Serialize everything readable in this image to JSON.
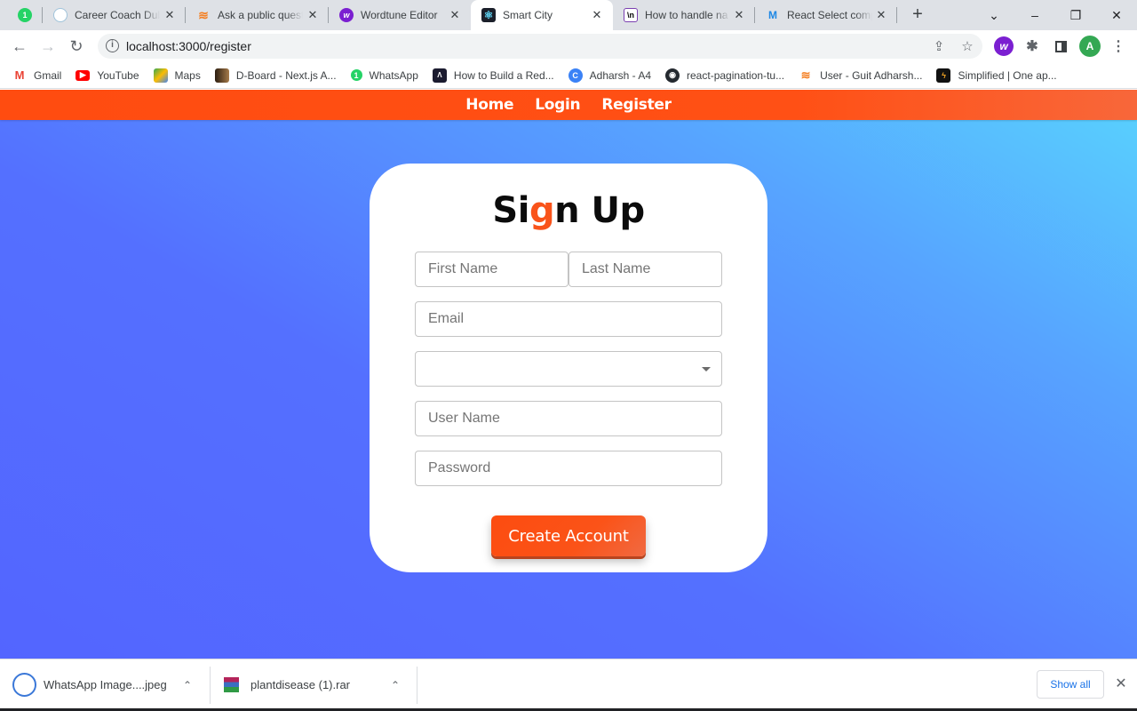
{
  "browser": {
    "tabs": [
      {
        "title": "",
        "icon": "whatsapp-icon",
        "color": "#25d366",
        "badge": "1"
      },
      {
        "title": "Career Coach Dub",
        "icon": "career-coach-icon",
        "color": "#cfe3f0"
      },
      {
        "title": "Ask a public quest",
        "icon": "stackoverflow-icon",
        "color": "#f48024"
      },
      {
        "title": "Wordtune Editor",
        "icon": "wordtune-icon",
        "color": "#7b1fd1"
      },
      {
        "title": "Smart City",
        "icon": "react-icon",
        "color": "#1b1f2a",
        "active": true
      },
      {
        "title": "How to handle na",
        "icon": "dev-icon",
        "color": "#000000"
      },
      {
        "title": "React Select comp",
        "icon": "mui-icon",
        "color": "#1e88e5"
      }
    ],
    "new_tab_label": "+",
    "window_controls": {
      "dropdown": "⌄",
      "minimize": "–",
      "restore": "❐",
      "close": "✕"
    },
    "url": "localhost:3000/register",
    "profile_initial": "A",
    "bookmarks": [
      {
        "label": "Gmail",
        "icon": "gmail-icon",
        "color": "#ea4335"
      },
      {
        "label": "YouTube",
        "icon": "youtube-icon",
        "color": "#ff0000"
      },
      {
        "label": "Maps",
        "icon": "maps-icon",
        "color": "#34a853"
      },
      {
        "label": "D-Board - Next.js A...",
        "icon": "dboard-icon",
        "color": "#6b4a2b"
      },
      {
        "label": "WhatsApp",
        "icon": "whatsapp-icon",
        "color": "#25d366"
      },
      {
        "label": "How to Build a Red...",
        "icon": "dev-icon",
        "color": "#1b1b2f"
      },
      {
        "label": "Adharsh - A4",
        "icon": "canva-icon",
        "color": "#3b82f6"
      },
      {
        "label": "react-pagination-tu...",
        "icon": "github-icon",
        "color": "#24292f"
      },
      {
        "label": "User - Guit Adharsh...",
        "icon": "stackoverflow-icon",
        "color": "#f48024"
      },
      {
        "label": "Simplified | One ap...",
        "icon": "simplified-icon",
        "color": "#111111"
      }
    ]
  },
  "app": {
    "nav": {
      "home": "Home",
      "login": "Login",
      "register": "Register"
    },
    "form": {
      "title_before": "Si",
      "title_accent": "g",
      "title_after": "n Up",
      "first_name_placeholder": "First Name",
      "last_name_placeholder": "Last Name",
      "email_placeholder": "Email",
      "select_value": "",
      "username_placeholder": "User Name",
      "password_placeholder": "Password",
      "submit_label": "Create Account"
    },
    "colors": {
      "accent": "#fc4c10",
      "bg_start": "#5365ff",
      "bg_end": "#58d3fe"
    }
  },
  "downloads": {
    "items": [
      {
        "name": "WhatsApp Image....jpeg",
        "icon": "progress-ring-icon"
      },
      {
        "name": "plantdisease (1).rar",
        "icon": "winrar-icon"
      }
    ],
    "show_all_label": "Show all"
  }
}
